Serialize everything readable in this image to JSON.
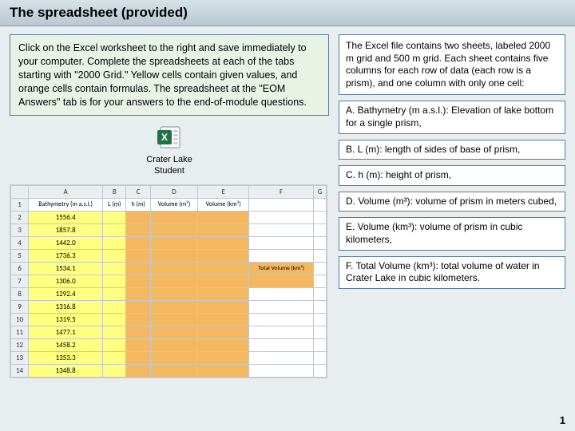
{
  "header": {
    "title": "The spreadsheet (provided)"
  },
  "instructions": "Click on the Excel worksheet to the right and save immediately to your computer.  Complete the spreadsheets at each of the tabs starting with \"2000 Grid.\"  Yellow cells contain given values, and orange cells contain formulas.  The spreadsheet at the \"EOM Answers\" tab is for your answers to the end-of-module questions.",
  "excel_link": {
    "line1": "Crater Lake",
    "line2": "Student"
  },
  "intro_box": "The Excel file contains two sheets, labeled 2000 m grid and 500 m grid.  Each sheet contains five columns for each row of data (each row is a prism), and one column with only one cell:",
  "column_descriptions": [
    "A. Bathymetry (m a.s.l.): Elevation of lake bottom for a single prism,",
    "B. L (m): length of sides of base of prism,",
    "C. h (m): height of prism,",
    "D. Volume (m³): volume of prism in meters cubed,",
    "E. Volume (km³): volume of prism in cubic kilometers,",
    "F. Total Volume (km³): total volume of water in Crater Lake in cubic kilometers."
  ],
  "sheet": {
    "cols": [
      "",
      "A",
      "B",
      "C",
      "D",
      "E",
      "F",
      "G"
    ],
    "hdr": [
      "Bathymetry (m a.s.l.)",
      "L (m)",
      "h (m)",
      "Volume (m³)",
      "Volume (km³)",
      "",
      ""
    ],
    "rows": [
      "1556.4",
      "1857.8",
      "1442.0",
      "1736.3",
      "1534.1",
      "1306.0",
      "1292.4",
      "1316.8",
      "1319.5",
      "1477.1",
      "1458.2",
      "1353.3",
      "1348.8"
    ],
    "total_label": "Total Volume (km³)"
  },
  "page_number": "1"
}
